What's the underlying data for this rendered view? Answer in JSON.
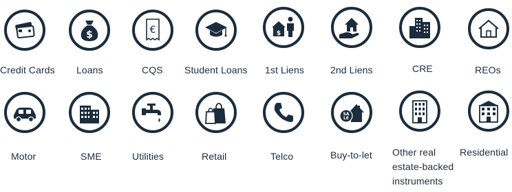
{
  "row1": [
    {
      "label": "Credit Cards",
      "icon": "credit-cards-icon"
    },
    {
      "label": "Loans",
      "icon": "money-bag-icon"
    },
    {
      "label": "CQS",
      "icon": "euro-receipt-icon"
    },
    {
      "label": "Student Loans",
      "icon": "graduation-cap-icon"
    },
    {
      "label": "1st Liens",
      "icon": "house-person-icon"
    },
    {
      "label": "2nd Liens",
      "icon": "house-in-hand-icon"
    },
    {
      "label": "CRE",
      "icon": "office-buildings-icon"
    },
    {
      "label": "REOs",
      "icon": "house-outline-icon"
    }
  ],
  "row2": [
    {
      "label": "Motor",
      "icon": "car-icon"
    },
    {
      "label": "SME",
      "icon": "factory-building-icon"
    },
    {
      "label": "Utilities",
      "icon": "water-tap-icon"
    },
    {
      "label": "Retail",
      "icon": "shopping-bags-icon"
    },
    {
      "label": "Telco",
      "icon": "telephone-icon"
    },
    {
      "label": "Buy-to-let",
      "icon": "sale-house-icon"
    },
    {
      "label": "Other real estate-backed instruments",
      "label_lines": [
        "Other real",
        "estate-backed",
        "instruments"
      ],
      "icon": "tall-building-icon"
    },
    {
      "label": "Residential",
      "icon": "apartment-building-icon"
    }
  ],
  "colors": {
    "icon": "#1b2c3c",
    "text": "#1b2c3c",
    "background": "#ffffff"
  }
}
